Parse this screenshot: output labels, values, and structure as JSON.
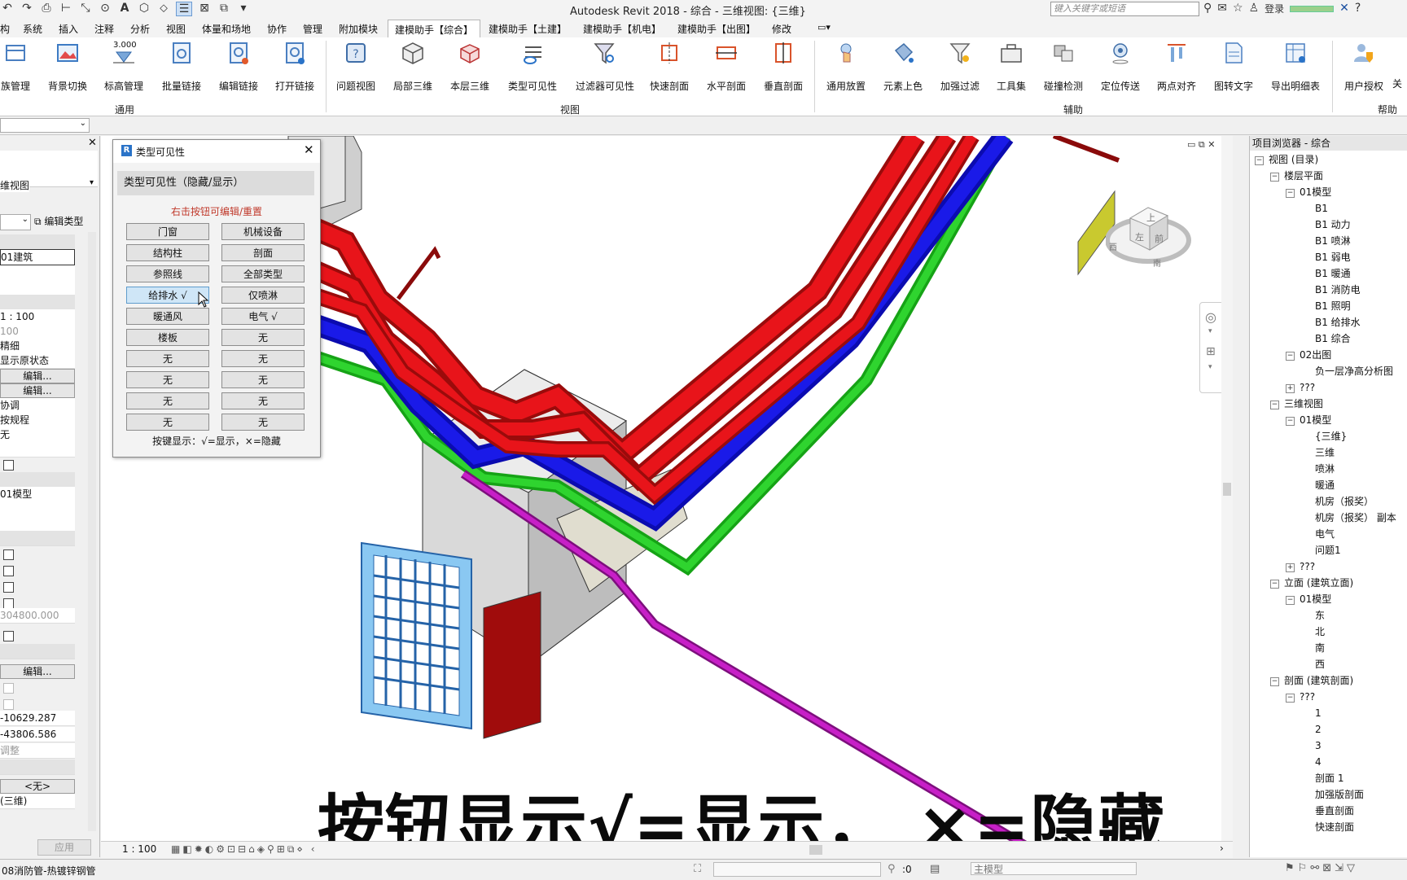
{
  "app": {
    "title": "Autodesk Revit 2018 -     综合 - 三维视图: {三维}",
    "search_placeholder": "键入关键字或短语",
    "login_label": "登录"
  },
  "tabs": [
    "构",
    "系统",
    "插入",
    "注释",
    "分析",
    "视图",
    "体量和场地",
    "协作",
    "管理",
    "附加模块",
    "建模助手【综合】",
    "建模助手【土建】",
    "建模助手【机电】",
    "建模助手【出图】",
    "修改"
  ],
  "active_tab": "建模助手【综合】",
  "ribbon": {
    "panels": [
      {
        "label": "通用",
        "buttons": [
          "族管理",
          "背景切换",
          "标高管理",
          "批量链接",
          "编辑链接",
          "打开链接"
        ]
      },
      {
        "label": "视图",
        "buttons": [
          "问题视图",
          "局部三维",
          "本层三维",
          "类型可见性",
          "过滤器可见性",
          "快速剖面",
          "水平剖面",
          "垂直剖面"
        ]
      },
      {
        "label": "辅助",
        "buttons": [
          "通用放置",
          "元素上色",
          "加强过滤",
          "工具集",
          "碰撞检测",
          "定位传送",
          "两点对齐",
          "图转文字",
          "导出明细表"
        ]
      },
      {
        "label": "帮助",
        "buttons": [
          "用户授权",
          "关"
        ]
      }
    ],
    "level_badge": "3.000"
  },
  "properties": {
    "view_type": "维视图",
    "edit_type_label": "编辑类型",
    "rows": [
      "01建筑",
      "",
      "",
      "1 : 100",
      "100",
      "精细",
      "显示原状态",
      "编辑...",
      "编辑...",
      "协调",
      "按规程",
      "无",
      "",
      "01模型",
      "",
      "",
      "304800.000",
      "编辑...",
      "-10629.287",
      "-43806.586",
      "调整",
      "<无>",
      "(三维)"
    ],
    "apply_label": "应用"
  },
  "dialog": {
    "title": "类型可见性",
    "header": "类型可见性（隐藏/显示）",
    "hint": "右击按钮可编辑/重置",
    "buttons": [
      [
        "门窗",
        "机械设备"
      ],
      [
        "结构柱",
        "剖面"
      ],
      [
        "参照线",
        "全部类型"
      ],
      [
        "给排水 √",
        "仅喷淋"
      ],
      [
        "暖通风",
        "电气 √"
      ],
      [
        "楼板",
        "无"
      ],
      [
        "无",
        "无"
      ],
      [
        "无",
        "无"
      ],
      [
        "无",
        "无"
      ],
      [
        "无",
        "无"
      ]
    ],
    "selected": "给排水 √",
    "footer": "按键显示：√=显示，×=隐藏"
  },
  "viewcube": {
    "top": "上",
    "front": "前",
    "left": "左",
    "compass_n": "南",
    "compass_w": "西"
  },
  "browser": {
    "title": "项目浏览器 - 综合",
    "nodes": [
      {
        "t": "视图 (目录)",
        "d": 0,
        "e": "-"
      },
      {
        "t": "楼层平面",
        "d": 1,
        "e": "-"
      },
      {
        "t": "01模型",
        "d": 2,
        "e": "-"
      },
      {
        "t": "B1",
        "d": 3
      },
      {
        "t": "B1 动力",
        "d": 3
      },
      {
        "t": "B1 喷淋",
        "d": 3
      },
      {
        "t": "B1 弱电",
        "d": 3
      },
      {
        "t": "B1 暖通",
        "d": 3
      },
      {
        "t": "B1 消防电",
        "d": 3
      },
      {
        "t": "B1 照明",
        "d": 3
      },
      {
        "t": "B1 给排水",
        "d": 3
      },
      {
        "t": "B1 综合",
        "d": 3
      },
      {
        "t": "02出图",
        "d": 2,
        "e": "-"
      },
      {
        "t": "负一层净高分析图",
        "d": 3
      },
      {
        "t": "???",
        "d": 2,
        "e": "+"
      },
      {
        "t": "三维视图",
        "d": 1,
        "e": "-"
      },
      {
        "t": "01模型",
        "d": 2,
        "e": "-"
      },
      {
        "t": "{三维}",
        "d": 3
      },
      {
        "t": "三维",
        "d": 3
      },
      {
        "t": "喷淋",
        "d": 3
      },
      {
        "t": "暖通",
        "d": 3
      },
      {
        "t": "机房（报奖）",
        "d": 3
      },
      {
        "t": "机房（报奖） 副本",
        "d": 3
      },
      {
        "t": "电气",
        "d": 3
      },
      {
        "t": "问题1",
        "d": 3
      },
      {
        "t": "???",
        "d": 2,
        "e": "+"
      },
      {
        "t": "立面 (建筑立面)",
        "d": 1,
        "e": "-"
      },
      {
        "t": "01模型",
        "d": 2,
        "e": "-"
      },
      {
        "t": "东",
        "d": 3
      },
      {
        "t": "北",
        "d": 3
      },
      {
        "t": "南",
        "d": 3
      },
      {
        "t": "西",
        "d": 3
      },
      {
        "t": "剖面 (建筑剖面)",
        "d": 1,
        "e": "-"
      },
      {
        "t": "???",
        "d": 2,
        "e": "-"
      },
      {
        "t": "1",
        "d": 3
      },
      {
        "t": "2",
        "d": 3
      },
      {
        "t": "3",
        "d": 3
      },
      {
        "t": "4",
        "d": 3
      },
      {
        "t": "剖面 1",
        "d": 3
      },
      {
        "t": "加强版剖面",
        "d": 3
      },
      {
        "t": "垂直剖面",
        "d": 3
      },
      {
        "t": "快速剖面",
        "d": 3
      }
    ]
  },
  "view_scale": "1 : 100",
  "status": {
    "left": "08消防管-热镀锌钢管",
    "coord": ":0",
    "model": "主模型"
  },
  "subtitle": "按钮显示√=显示， ×=隐藏",
  "colors": {
    "red_duct": "#e8141a",
    "blue_pipe": "#1414e6",
    "green_pipe": "#21c321",
    "magenta_pipe": "#c71fc7",
    "grille": "#5bb4ec",
    "accent": "#2a73c8"
  }
}
